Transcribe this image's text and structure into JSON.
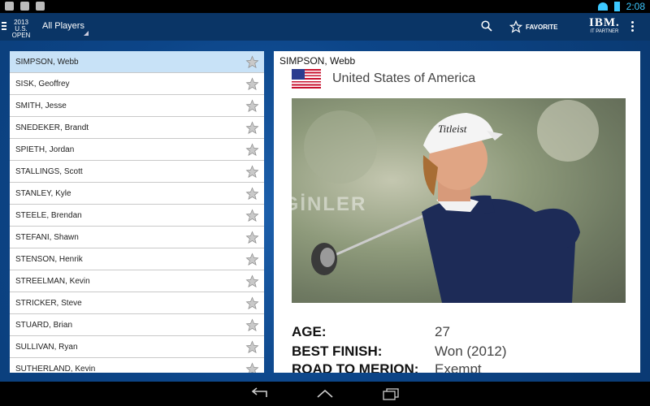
{
  "statusbar": {
    "time": "2:08"
  },
  "header": {
    "logo_year": "2013",
    "logo_name": "U.S. OPEN",
    "filter": "All Players",
    "favorite_label": "FAVORITE",
    "partner_logo": "IBM.",
    "partner_caption": "IT PARTNER"
  },
  "players": [
    {
      "name": "SIMPSON, Webb"
    },
    {
      "name": "SISK, Geoffrey"
    },
    {
      "name": "SMITH, Jesse"
    },
    {
      "name": "SNEDEKER, Brandt"
    },
    {
      "name": "SPIETH, Jordan"
    },
    {
      "name": "STALLINGS, Scott"
    },
    {
      "name": "STANLEY, Kyle"
    },
    {
      "name": "STEELE, Brendan"
    },
    {
      "name": "STEFANI, Shawn"
    },
    {
      "name": "STENSON, Henrik"
    },
    {
      "name": "STREELMAN, Kevin"
    },
    {
      "name": "STRICKER, Steve"
    },
    {
      "name": "STUARD, Brian"
    },
    {
      "name": "SULLIVAN, Ryan"
    },
    {
      "name": "SUTHERLAND, Kevin"
    }
  ],
  "detail": {
    "name": "SIMPSON, Webb",
    "country": "United States of America",
    "watermark": "EZGİNLER",
    "cap_brand": "Titleist",
    "stats": [
      {
        "label": "AGE:",
        "value": "27"
      },
      {
        "label": "BEST FINISH:",
        "value": "Won (2012)"
      },
      {
        "label": "ROAD TO MERION:",
        "value": "Exempt"
      }
    ]
  }
}
